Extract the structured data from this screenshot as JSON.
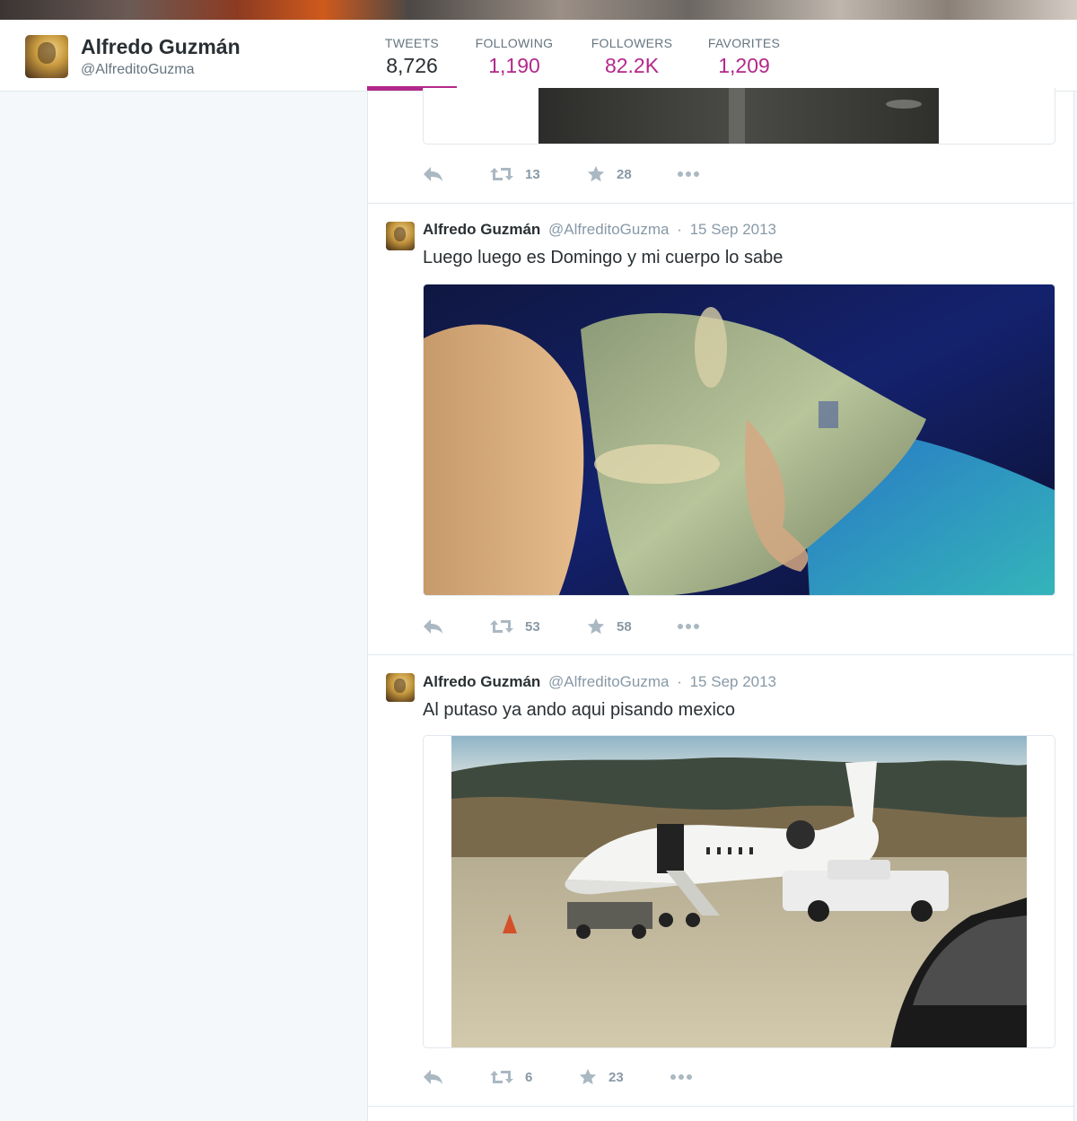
{
  "profile": {
    "name": "Alfredo Guzmán",
    "handle": "@AlfreditoGuzma"
  },
  "stats": [
    {
      "label": "TWEETS",
      "value": "8,726",
      "active": true
    },
    {
      "label": "FOLLOWING",
      "value": "1,190",
      "active": false
    },
    {
      "label": "FOLLOWERS",
      "value": "82.2K",
      "active": false
    },
    {
      "label": "FAVORITES",
      "value": "1,209",
      "active": false
    }
  ],
  "colors": {
    "accent": "#b3288a",
    "page_bg": "#f5f8fa",
    "border": "#e1e8ed",
    "muted_text": "#8899a6",
    "icon": "#aab8c2"
  },
  "tweets": [
    {
      "partial": true,
      "retweets": "13",
      "favorites": "28"
    },
    {
      "name": "Alfredo Guzmán",
      "handle": "@AlfreditoGuzma",
      "separator": "·",
      "date": "15 Sep 2013",
      "text": "Luego luego es Domingo y mi cuerpo lo sabe",
      "retweets": "53",
      "favorites": "58"
    },
    {
      "name": "Alfredo Guzmán",
      "handle": "@AlfreditoGuzma",
      "separator": "·",
      "date": "15 Sep 2013",
      "text": "Al putaso ya ando aqui pisando mexico",
      "retweets": "6",
      "favorites": "23"
    }
  ],
  "icons": {
    "reply": "reply-icon",
    "retweet": "retweet-icon",
    "favorite": "star-icon",
    "more": "more-icon"
  }
}
